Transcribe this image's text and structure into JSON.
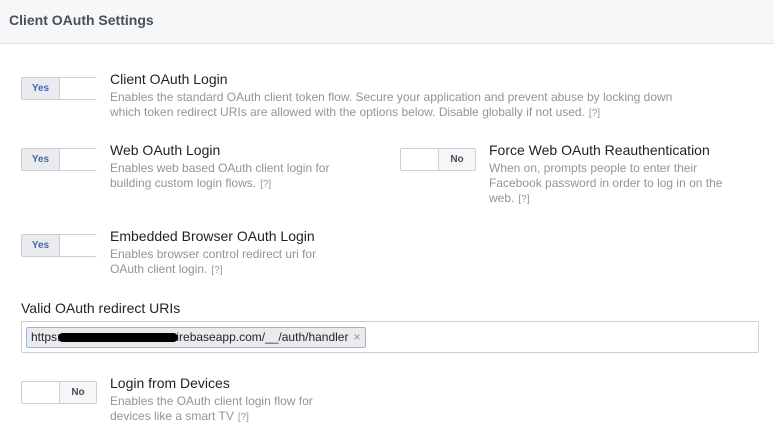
{
  "header": {
    "title": "Client OAuth Settings"
  },
  "settings": {
    "client_login": {
      "toggle": "Yes",
      "title": "Client OAuth Login",
      "desc_line1": "Enables the standard OAuth client token flow. Secure your application and prevent abuse by locking down",
      "desc_line2": "which token redirect URIs are allowed with the options below. Disable globally if not used.",
      "help": "[?]"
    },
    "web_login": {
      "toggle": "Yes",
      "title": "Web OAuth Login",
      "desc_line1": "Enables web based OAuth client login for",
      "desc_line2": "building custom login flows.",
      "help": "[?]"
    },
    "force_reauth": {
      "toggle": "No",
      "title": "Force Web OAuth Reauthentication",
      "desc_line1": "When on, prompts people to enter their",
      "desc_line2": "Facebook password in order to log in on the",
      "desc_line3": "web.",
      "help": "[?]"
    },
    "embedded_browser": {
      "toggle": "Yes",
      "title": "Embedded Browser OAuth Login",
      "desc_line1": "Enables browser control redirect uri for",
      "desc_line2": "OAuth client login.",
      "help": "[?]"
    },
    "devices": {
      "toggle": "No",
      "title": "Login from Devices",
      "desc_line1": "Enables the OAuth client login flow for",
      "desc_line2": "devices like a smart TV",
      "help": "[?]"
    }
  },
  "redirect_uris": {
    "label": "Valid OAuth redirect URIs",
    "token_prefix": "https:",
    "token_suffix": "irebaseapp.com/__/auth/handler",
    "remove": "×"
  }
}
